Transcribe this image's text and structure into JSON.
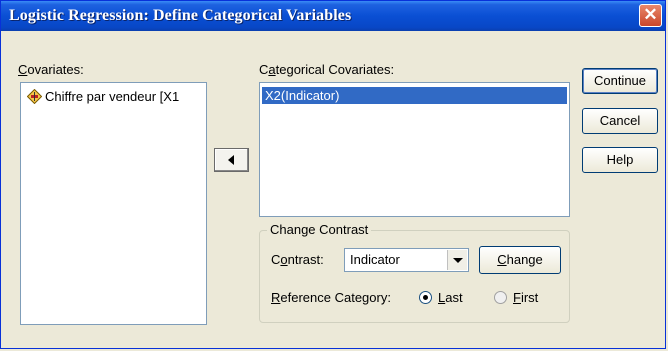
{
  "window": {
    "title": "Logistic Regression: Define Categorical Variables",
    "close_glyph": "✕"
  },
  "covariates": {
    "label": "Covariates:",
    "items": [
      "Chiffre par vendeur [X1"
    ]
  },
  "categorical": {
    "label": "Categorical Covariates:",
    "items": [
      "X2(Indicator)"
    ]
  },
  "move_button_glyph": "◄",
  "buttons": {
    "continue": "Continue",
    "cancel": "Cancel",
    "help": "Help"
  },
  "change_contrast": {
    "title": "Change Contrast",
    "contrast_label": "Contrast:",
    "contrast_value": "Indicator",
    "change_button": "Change",
    "reference_label": "Reference Category:",
    "last_label": "Last",
    "first_label": "First",
    "selected": "Last"
  }
}
